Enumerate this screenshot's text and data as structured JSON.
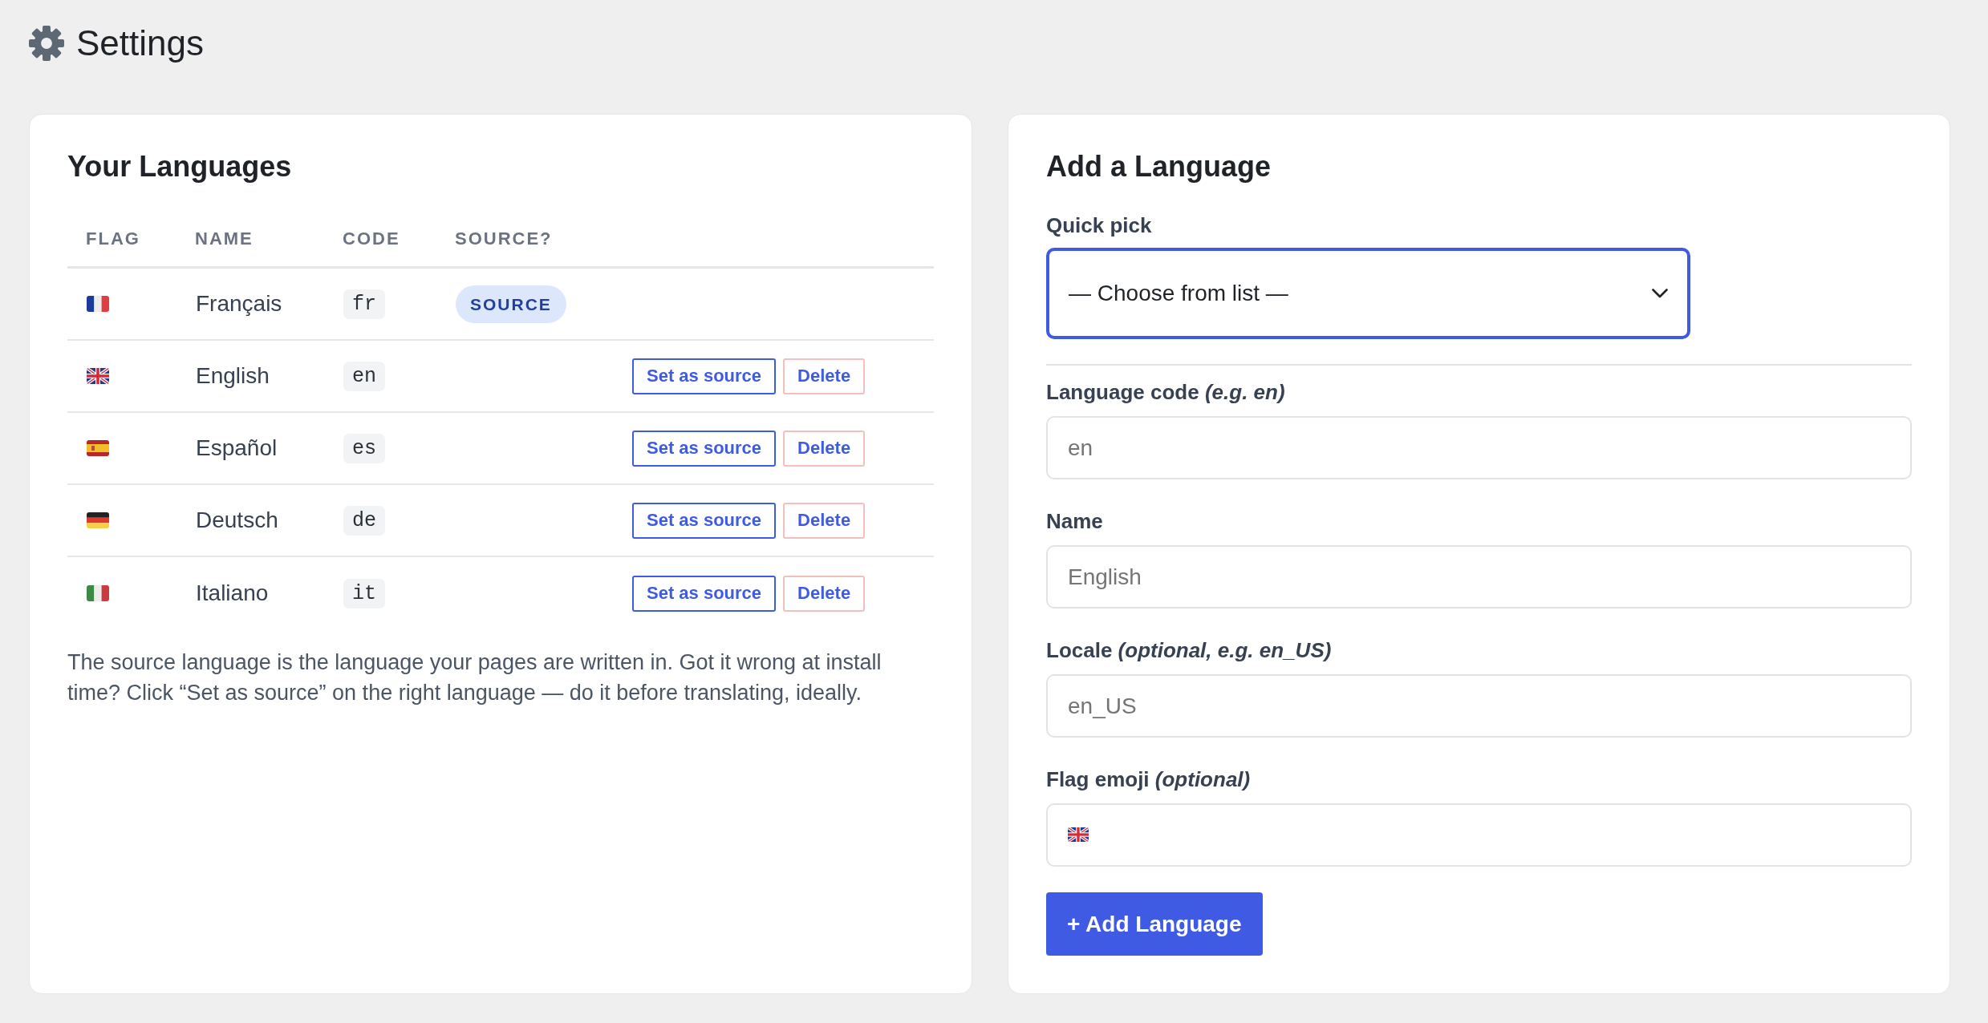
{
  "page": {
    "title": "Settings"
  },
  "languages": {
    "title": "Your Languages",
    "columns": [
      "FLAG",
      "NAME",
      "CODE",
      "SOURCE?"
    ],
    "rows": [
      {
        "flag": {
          "kind": "france"
        },
        "name": "Français",
        "code": "fr",
        "source": true,
        "badge": "SOURCE"
      },
      {
        "flag": {
          "kind": "britain"
        },
        "name": "English",
        "code": "en",
        "source": false,
        "actions": [
          {
            "kind": "primary",
            "label": "Set as source"
          },
          {
            "kind": "danger",
            "label": "Delete"
          }
        ]
      },
      {
        "flag": {
          "kind": "spain"
        },
        "name": "Español",
        "code": "es",
        "source": false,
        "actions": [
          {
            "kind": "primary",
            "label": "Set as source"
          },
          {
            "kind": "danger",
            "label": "Delete"
          }
        ]
      },
      {
        "flag": {
          "kind": "germany"
        },
        "name": "Deutsch",
        "code": "de",
        "source": false,
        "actions": [
          {
            "kind": "primary",
            "label": "Set as source"
          },
          {
            "kind": "danger",
            "label": "Delete"
          }
        ]
      },
      {
        "flag": {
          "kind": "italy"
        },
        "name": "Italiano",
        "code": "it",
        "source": false,
        "actions": [
          {
            "kind": "primary",
            "label": "Set as source"
          },
          {
            "kind": "danger",
            "label": "Delete"
          }
        ]
      }
    ],
    "note": "The source language is the language your pages are written in. Got it wrong at install time? Click “Set as source” on the right language — do it before translating, ideally."
  },
  "add_form": {
    "title": "Add a Language",
    "quick_pick": {
      "label": "Quick pick",
      "value": "— Choose from list —",
      "focused": true
    },
    "fields": [
      {
        "kind": "text",
        "label": "Language code *(e.g. en)*",
        "placeholder": "en"
      },
      {
        "kind": "text",
        "label": "Name",
        "placeholder": "English"
      },
      {
        "kind": "text",
        "label": "Locale *(optional, e.g. en_US)*",
        "placeholder": "en_US"
      },
      {
        "kind": "flag",
        "label": "Flag emoji *(optional)*",
        "flag": {
          "kind": "britain"
        }
      }
    ],
    "submit": "+ Add Language"
  }
}
